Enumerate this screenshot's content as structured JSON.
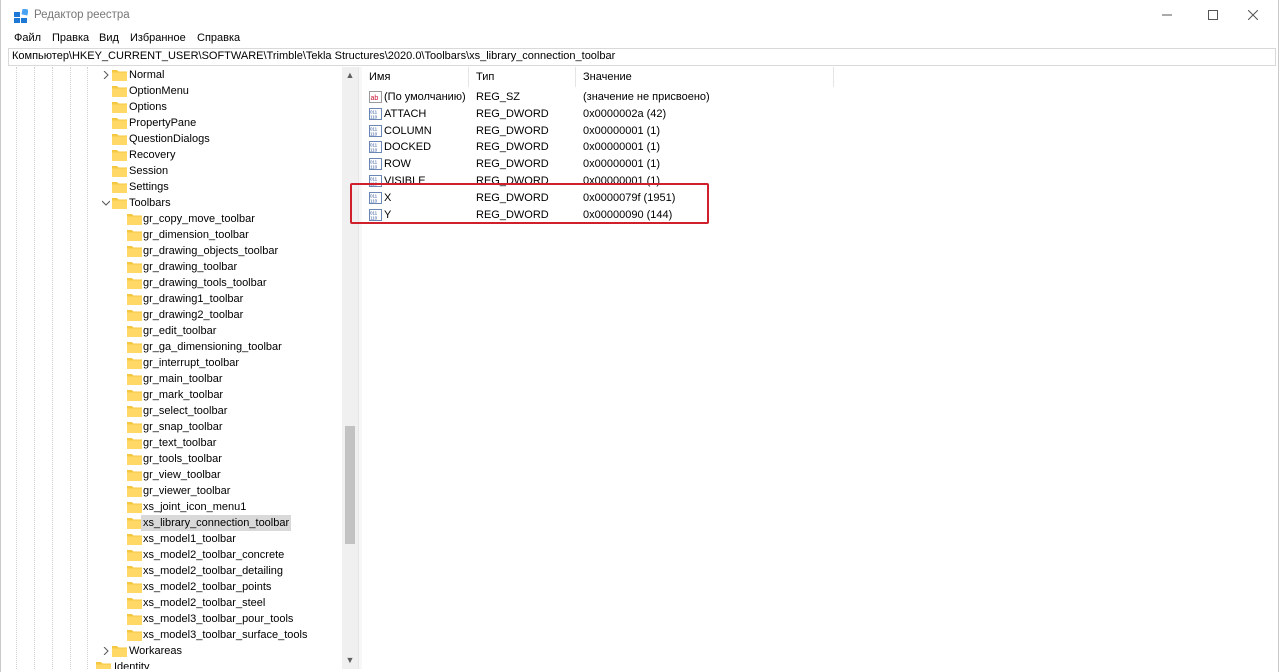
{
  "window": {
    "title": "Редактор реестра"
  },
  "menu": [
    "Файл",
    "Правка",
    "Вид",
    "Избранное",
    "Справка"
  ],
  "address": "Компьютер\\HKEY_CURRENT_USER\\SOFTWARE\\Trimble\\Tekla Structures\\2020.0\\Toolbars\\xs_library_connection_toolbar",
  "tree": {
    "items": [
      {
        "label": "Normal",
        "expandable": true,
        "expanded": false,
        "depth": 0
      },
      {
        "label": "OptionMenu",
        "expandable": false,
        "depth": 0
      },
      {
        "label": "Options",
        "expandable": false,
        "depth": 0
      },
      {
        "label": "PropertyPane",
        "expandable": false,
        "depth": 0
      },
      {
        "label": "QuestionDialogs",
        "expandable": false,
        "depth": 0
      },
      {
        "label": "Recovery",
        "expandable": false,
        "depth": 0
      },
      {
        "label": "Session",
        "expandable": false,
        "depth": 0
      },
      {
        "label": "Settings",
        "expandable": false,
        "depth": 0
      },
      {
        "label": "Toolbars",
        "expandable": true,
        "expanded": true,
        "depth": 0
      },
      {
        "label": "gr_copy_move_toolbar",
        "depth": 1
      },
      {
        "label": "gr_dimension_toolbar",
        "depth": 1
      },
      {
        "label": "gr_drawing_objects_toolbar",
        "depth": 1
      },
      {
        "label": "gr_drawing_toolbar",
        "depth": 1
      },
      {
        "label": "gr_drawing_tools_toolbar",
        "depth": 1
      },
      {
        "label": "gr_drawing1_toolbar",
        "depth": 1
      },
      {
        "label": "gr_drawing2_toolbar",
        "depth": 1
      },
      {
        "label": "gr_edit_toolbar",
        "depth": 1
      },
      {
        "label": "gr_ga_dimensioning_toolbar",
        "depth": 1
      },
      {
        "label": "gr_interrupt_toolbar",
        "depth": 1
      },
      {
        "label": "gr_main_toolbar",
        "depth": 1
      },
      {
        "label": "gr_mark_toolbar",
        "depth": 1
      },
      {
        "label": "gr_select_toolbar",
        "depth": 1
      },
      {
        "label": "gr_snap_toolbar",
        "depth": 1
      },
      {
        "label": "gr_text_toolbar",
        "depth": 1
      },
      {
        "label": "gr_tools_toolbar",
        "depth": 1
      },
      {
        "label": "gr_view_toolbar",
        "depth": 1
      },
      {
        "label": "gr_viewer_toolbar",
        "depth": 1
      },
      {
        "label": "xs_joint_icon_menu1",
        "depth": 1
      },
      {
        "label": "xs_library_connection_toolbar",
        "depth": 1,
        "selected": true
      },
      {
        "label": "xs_model1_toolbar",
        "depth": 1
      },
      {
        "label": "xs_model2_toolbar_concrete",
        "depth": 1
      },
      {
        "label": "xs_model2_toolbar_detailing",
        "depth": 1
      },
      {
        "label": "xs_model2_toolbar_points",
        "depth": 1
      },
      {
        "label": "xs_model2_toolbar_steel",
        "depth": 1
      },
      {
        "label": "xs_model3_toolbar_pour_tools",
        "depth": 1
      },
      {
        "label": "xs_model3_toolbar_surface_tools",
        "depth": 1
      },
      {
        "label": "Workareas",
        "expandable": true,
        "expanded": false,
        "depth": 0
      },
      {
        "label": "Identity",
        "expandable": false,
        "depth": -1
      }
    ]
  },
  "list": {
    "headers": {
      "name": "Имя",
      "type": "Тип",
      "value": "Значение"
    },
    "rows": [
      {
        "icon": "string-value-icon",
        "name": "(По умолчанию)",
        "type": "REG_SZ",
        "value": "(значение не присвоено)"
      },
      {
        "icon": "binary-value-icon",
        "name": "ATTACH",
        "type": "REG_DWORD",
        "value": "0x0000002a (42)"
      },
      {
        "icon": "binary-value-icon",
        "name": "COLUMN",
        "type": "REG_DWORD",
        "value": "0x00000001 (1)"
      },
      {
        "icon": "binary-value-icon",
        "name": "DOCKED",
        "type": "REG_DWORD",
        "value": "0x00000001 (1)"
      },
      {
        "icon": "binary-value-icon",
        "name": "ROW",
        "type": "REG_DWORD",
        "value": "0x00000001 (1)"
      },
      {
        "icon": "binary-value-icon",
        "name": "VISIBLE",
        "type": "REG_DWORD",
        "value": "0x00000001 (1)"
      },
      {
        "icon": "binary-value-icon",
        "name": "X",
        "type": "REG_DWORD",
        "value": "0x0000079f (1951)"
      },
      {
        "icon": "binary-value-icon",
        "name": "Y",
        "type": "REG_DWORD",
        "value": "0x00000090 (144)"
      }
    ]
  },
  "colors": {
    "folder": "#f5c842",
    "highlight": "#d0202b",
    "selection": "#d9d9d9",
    "accent": "#1e78d6"
  }
}
